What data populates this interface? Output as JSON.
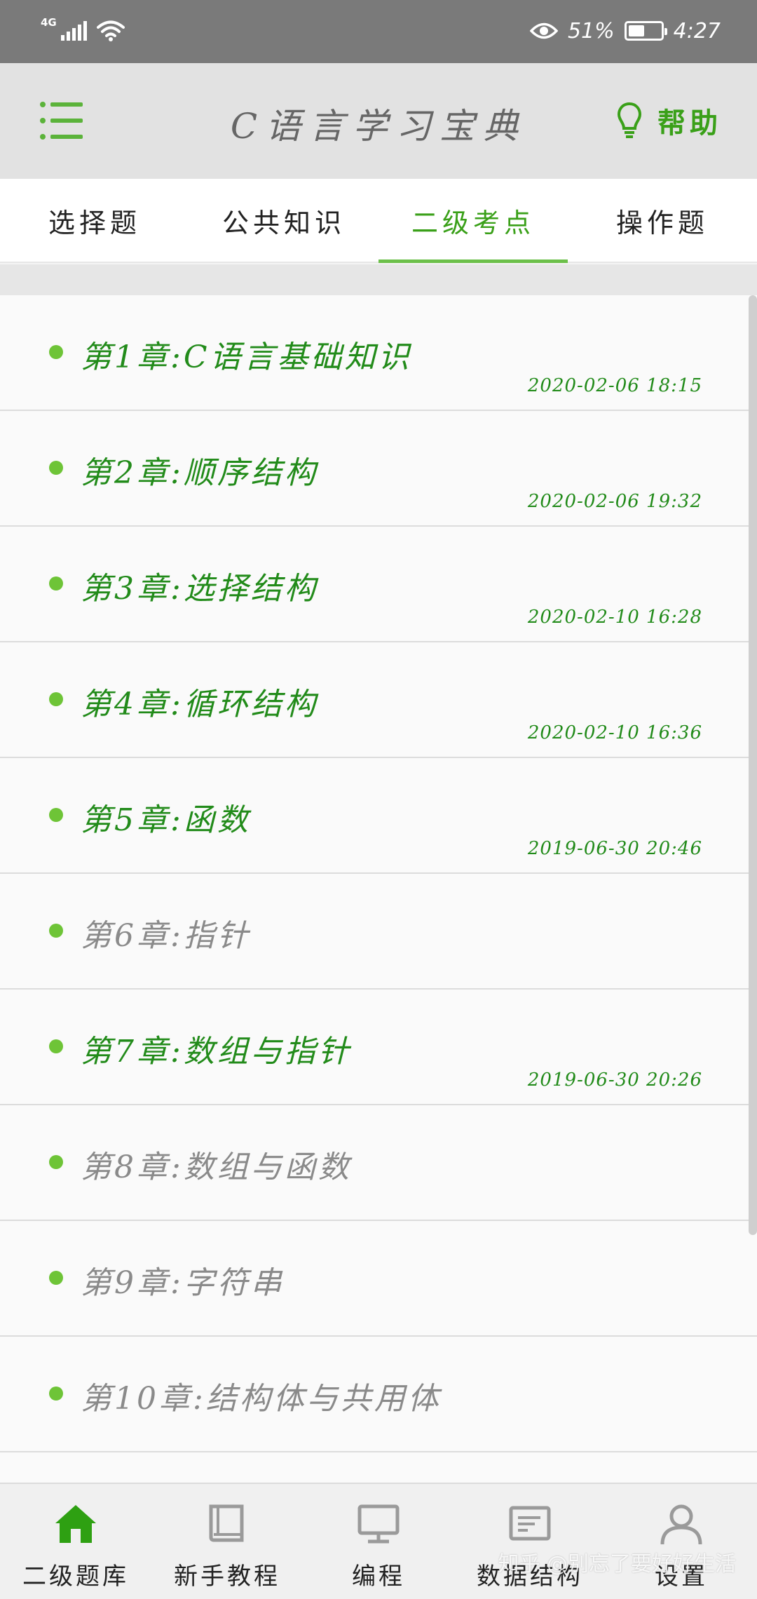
{
  "status_bar": {
    "network": "4G",
    "battery_percent_text": "51%",
    "battery_level": 0.51,
    "time": "4:27"
  },
  "app_bar": {
    "title": "C语言学习宝典",
    "help_label": "帮助",
    "menu_icon": "menu-icon",
    "help_icon": "lightbulb-icon"
  },
  "tabs": [
    {
      "label": "选择题",
      "active": false
    },
    {
      "label": "公共知识",
      "active": false
    },
    {
      "label": "二级考点",
      "active": true
    },
    {
      "label": "操作题",
      "active": false
    }
  ],
  "chapters": [
    {
      "title": "第1章:C语言基础知识",
      "date": "2020-02-06 18:15",
      "status": "done"
    },
    {
      "title": "第2章:顺序结构",
      "date": "2020-02-06 19:32",
      "status": "done"
    },
    {
      "title": "第3章:选择结构",
      "date": "2020-02-10 16:28",
      "status": "done"
    },
    {
      "title": "第4章:循环结构",
      "date": "2020-02-10 16:36",
      "status": "done"
    },
    {
      "title": "第5章:函数",
      "date": "2019-06-30 20:46",
      "status": "done"
    },
    {
      "title": "第6章:指针",
      "date": "",
      "status": "todo"
    },
    {
      "title": "第7章:数组与指针",
      "date": "2019-06-30 20:26",
      "status": "done"
    },
    {
      "title": "第8章:数组与函数",
      "date": "",
      "status": "todo"
    },
    {
      "title": "第9章:字符串",
      "date": "",
      "status": "todo"
    },
    {
      "title": "第10章:结构体与共用体",
      "date": "",
      "status": "todo"
    },
    {
      "title": "",
      "date": "",
      "status": "todo"
    }
  ],
  "bottom_nav": [
    {
      "label": "二级题库",
      "icon": "home-icon",
      "active": true
    },
    {
      "label": "新手教程",
      "icon": "book-icon",
      "active": false
    },
    {
      "label": "编程",
      "icon": "monitor-icon",
      "active": false
    },
    {
      "label": "数据结构",
      "icon": "data-structure-icon",
      "active": false
    },
    {
      "label": "设置",
      "icon": "user-icon",
      "active": false
    }
  ],
  "watermark": "知乎 @别忘了要好好生活",
  "colors": {
    "accent": "#3aa019",
    "chapter_done": "#228b1a",
    "chapter_todo": "#8a8a8a",
    "dot": "#6ec437"
  }
}
